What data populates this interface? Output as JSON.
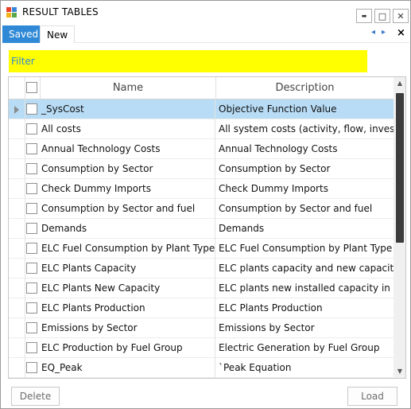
{
  "window": {
    "title": "RESULT TABLES",
    "minimize_glyph": "▬",
    "maximize_glyph": "□",
    "close_glyph": "✕",
    "icon_colors": [
      "#e8412c",
      "#3a86d6",
      "#f2b21a",
      "#5aa64a"
    ]
  },
  "tabs": [
    {
      "label": "Saved",
      "active": true
    },
    {
      "label": "New",
      "active": false
    }
  ],
  "tab_controls": {
    "prev": "◂",
    "next": "▸",
    "close": "×"
  },
  "filter": {
    "placeholder": "Filter",
    "value": ""
  },
  "grid": {
    "columns": [
      "Name",
      "Description"
    ],
    "rows": [
      {
        "name": "_SysCost",
        "description": "Objective Function Value",
        "selected": true
      },
      {
        "name": "All costs",
        "description": "All system costs (activity, flow, invest..."
      },
      {
        "name": "Annual Technology Costs",
        "description": "Annual Technology Costs"
      },
      {
        "name": "Consumption by Sector",
        "description": "Consumption by Sector"
      },
      {
        "name": "Check Dummy Imports",
        "description": "Check Dummy Imports"
      },
      {
        "name": "Consumption by Sector and fuel",
        "description": "Consumption by Sector and fuel"
      },
      {
        "name": "Demands",
        "description": "Demands"
      },
      {
        "name": "ELC Fuel Consumption by Plant Type",
        "description": "ELC Fuel Consumption by Plant Type"
      },
      {
        "name": "ELC Plants Capacity",
        "description": "ELC plants capacity and new capacity"
      },
      {
        "name": "ELC Plants New Capacity",
        "description": "ELC plants new installed capacity in ea..."
      },
      {
        "name": "ELC Plants Production",
        "description": "ELC Plants Production"
      },
      {
        "name": "Emissions by Sector",
        "description": "Emissions by Sector"
      },
      {
        "name": "ELC Production by Fuel Group",
        "description": "Electric Generation by Fuel Group"
      },
      {
        "name": "EQ_Peak",
        "description": "`Peak Equation"
      }
    ]
  },
  "scrollbar": {
    "up": "▲",
    "down": "▼"
  },
  "buttons": {
    "delete": "Delete",
    "load": "Load"
  }
}
